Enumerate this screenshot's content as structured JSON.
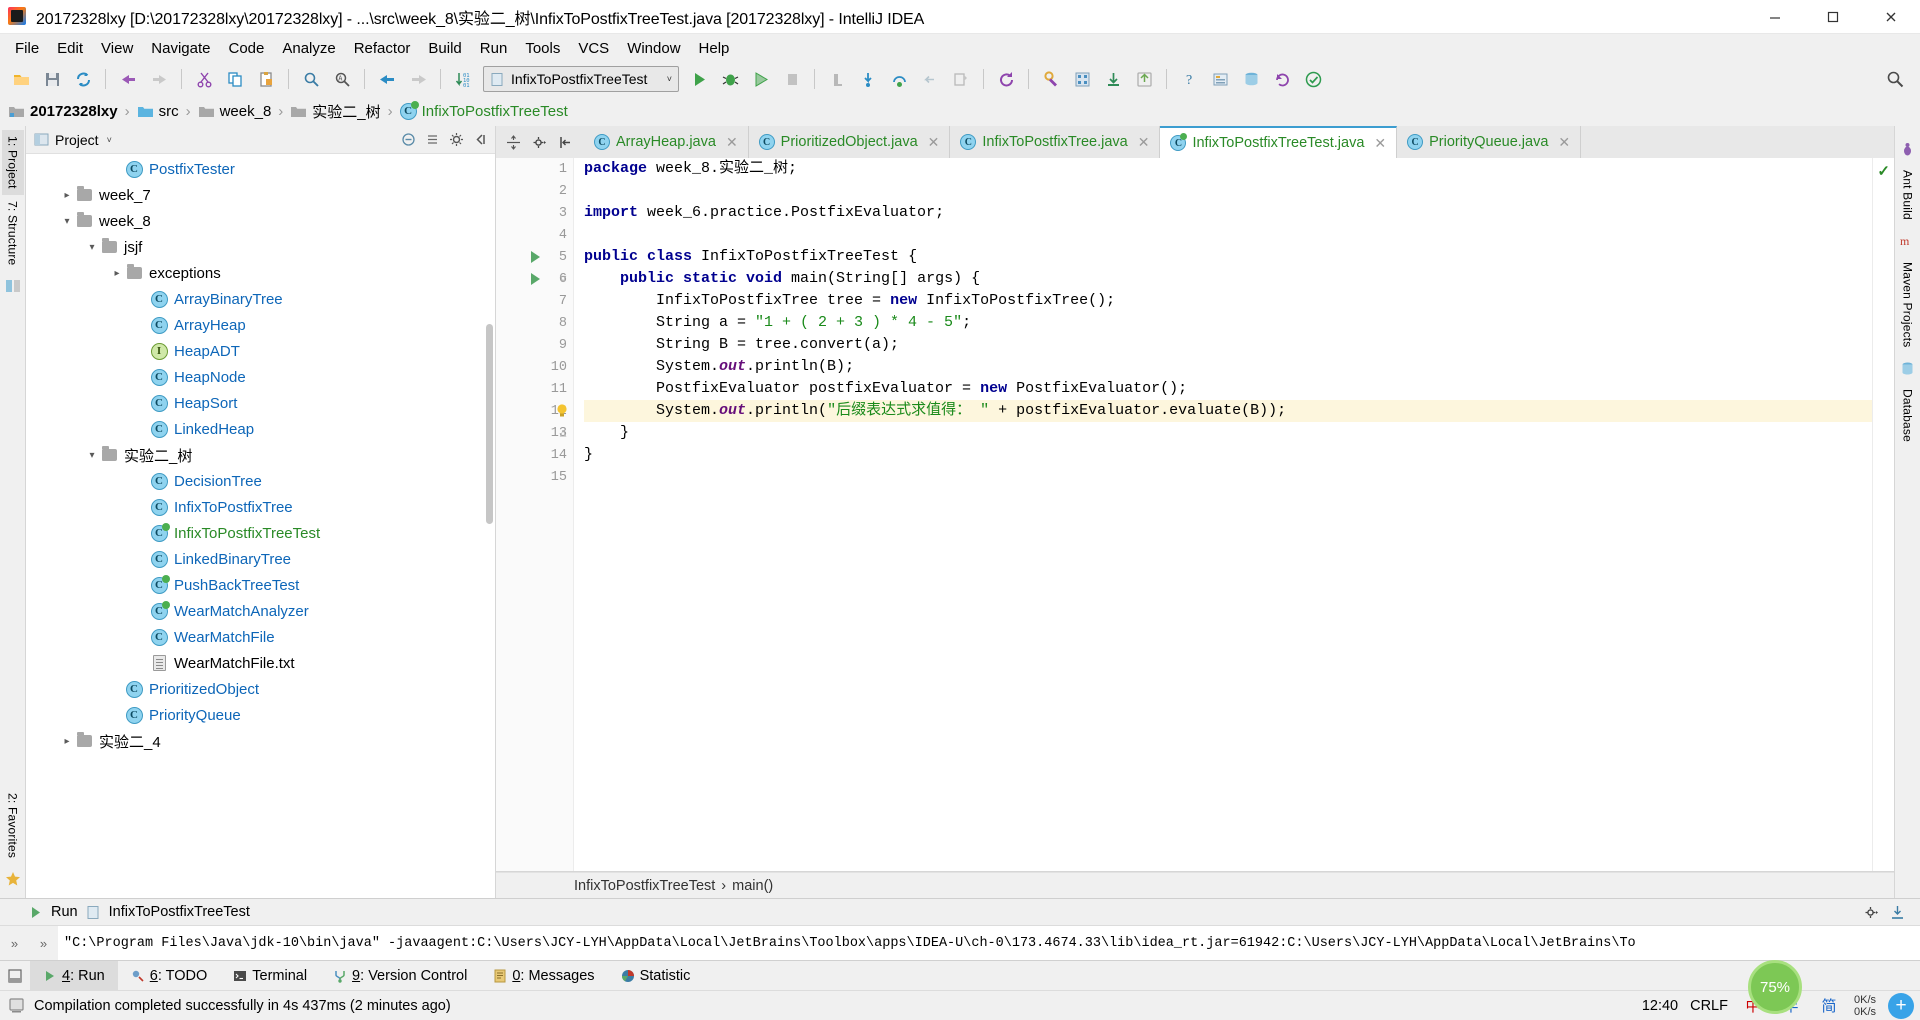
{
  "window": {
    "title": "20172328lxy [D:\\20172328lxy\\20172328lxy] - ...\\src\\week_8\\实验二_树\\InfixToPostfixTreeTest.java [20172328lxy] - IntelliJ IDEA",
    "minimize": "—",
    "maximize": "▢",
    "close": "✕"
  },
  "menubar": {
    "items": [
      {
        "label": "File"
      },
      {
        "label": "Edit"
      },
      {
        "label": "View"
      },
      {
        "label": "Navigate"
      },
      {
        "label": "Code"
      },
      {
        "label": "Analyze"
      },
      {
        "label": "Refactor"
      },
      {
        "label": "Build"
      },
      {
        "label": "Run"
      },
      {
        "label": "Tools"
      },
      {
        "label": "VCS"
      },
      {
        "label": "Window"
      },
      {
        "label": "Help"
      }
    ]
  },
  "toolbar": {
    "run_config": "InfixToPostfixTreeTest",
    "caret": "˅",
    "icons": [
      "open-folder-icon",
      "save-all-icon",
      "sync-icon",
      "undo-icon",
      "redo-icon",
      "cut-icon",
      "copy-icon",
      "paste-icon",
      "find-icon",
      "replace-icon",
      "back-icon",
      "forward-icon",
      "sort-icon"
    ],
    "run_icons": [
      "run-icon",
      "debug-icon",
      "coverage-icon",
      "stop-icon",
      "stop-gray-icon",
      "step-in-icon",
      "step-over-icon",
      "step-out-icon",
      "evaluate-icon",
      "rerun-icon",
      "settings-wrench-icon",
      "database-icon",
      "help-icon",
      "project-structure-icon",
      "update-icon",
      "check-icon"
    ],
    "search_everywhere": "search-everywhere-icon"
  },
  "breadcrumb": {
    "items": [
      {
        "label": "20172328lxy",
        "icon": "module-icon",
        "style": "bold"
      },
      {
        "label": "src",
        "icon": "source-folder-icon",
        "style": "normal"
      },
      {
        "label": "week_8",
        "icon": "folder-icon",
        "style": "normal"
      },
      {
        "label": "实验二_树",
        "icon": "folder-icon",
        "style": "normal"
      },
      {
        "label": "InfixToPostfixTreeTest",
        "icon": "class-icon",
        "style": "green"
      }
    ],
    "separator": "›"
  },
  "left_rail": {
    "tabs": [
      {
        "label": "1: Project",
        "selected": true
      },
      {
        "label": "7: Structure",
        "selected": false
      }
    ],
    "bottom": [
      {
        "label": "2: Favorites"
      }
    ],
    "icons": [
      "database-rail-icon",
      "commander-icon",
      "favorites-star-icon"
    ]
  },
  "right_rail": {
    "tabs": [
      {
        "label": "Ant Build"
      },
      {
        "label": "Maven Projects"
      },
      {
        "label": "Database"
      }
    ]
  },
  "project_panel": {
    "title": "Project",
    "caret": "˅",
    "buttons": [
      "collapse-all-icon",
      "expand-icon",
      "settings-gear-icon",
      "hide-icon"
    ],
    "tree": [
      {
        "indent": 3,
        "arrow": "",
        "icon": "class",
        "label": "PostfixTester",
        "color": "blue"
      },
      {
        "indent": 1,
        "arrow": "›",
        "icon": "folder",
        "label": "week_7",
        "color": "black"
      },
      {
        "indent": 1,
        "arrow": "˅",
        "icon": "folder",
        "label": "week_8",
        "color": "black"
      },
      {
        "indent": 2,
        "arrow": "˅",
        "icon": "folder",
        "label": "jsjf",
        "color": "black"
      },
      {
        "indent": 3,
        "arrow": "›",
        "icon": "folder",
        "label": "exceptions",
        "color": "black"
      },
      {
        "indent": 4,
        "arrow": "",
        "icon": "class",
        "label": "ArrayBinaryTree",
        "color": "blue"
      },
      {
        "indent": 4,
        "arrow": "",
        "icon": "class",
        "label": "ArrayHeap",
        "color": "blue"
      },
      {
        "indent": 4,
        "arrow": "",
        "icon": "interface",
        "label": "HeapADT",
        "color": "blue"
      },
      {
        "indent": 4,
        "arrow": "",
        "icon": "class",
        "label": "HeapNode",
        "color": "blue"
      },
      {
        "indent": 4,
        "arrow": "",
        "icon": "class",
        "label": "HeapSort",
        "color": "blue"
      },
      {
        "indent": 4,
        "arrow": "",
        "icon": "class",
        "label": "LinkedHeap",
        "color": "blue"
      },
      {
        "indent": 2,
        "arrow": "˅",
        "icon": "folder",
        "label": "实验二_树",
        "color": "black"
      },
      {
        "indent": 4,
        "arrow": "",
        "icon": "class",
        "label": "DecisionTree",
        "color": "blue"
      },
      {
        "indent": 4,
        "arrow": "",
        "icon": "class",
        "label": "InfixToPostfixTree",
        "color": "blue"
      },
      {
        "indent": 4,
        "arrow": "",
        "icon": "class-runnable",
        "label": "InfixToPostfixTreeTest",
        "color": "green"
      },
      {
        "indent": 4,
        "arrow": "",
        "icon": "class",
        "label": "LinkedBinaryTree",
        "color": "blue"
      },
      {
        "indent": 4,
        "arrow": "",
        "icon": "class-runnable",
        "label": "PushBackTreeTest",
        "color": "blue"
      },
      {
        "indent": 4,
        "arrow": "",
        "icon": "class-runnable",
        "label": "WearMatchAnalyzer",
        "color": "blue"
      },
      {
        "indent": 4,
        "arrow": "",
        "icon": "class",
        "label": "WearMatchFile",
        "color": "blue"
      },
      {
        "indent": 4,
        "arrow": "",
        "icon": "text",
        "label": "WearMatchFile.txt",
        "color": "black"
      },
      {
        "indent": 3,
        "arrow": "",
        "icon": "class",
        "label": "PrioritizedObject",
        "color": "blue"
      },
      {
        "indent": 3,
        "arrow": "",
        "icon": "class",
        "label": "PriorityQueue",
        "color": "blue"
      },
      {
        "indent": 1,
        "arrow": "›",
        "icon": "folder",
        "label": "实验二_4",
        "color": "black"
      }
    ]
  },
  "editor": {
    "tabs": [
      {
        "label": "ArrayHeap.java",
        "icon": "class-icon",
        "active": false,
        "close": "✕"
      },
      {
        "label": "PrioritizedObject.java",
        "icon": "class-icon",
        "active": false,
        "close": "✕"
      },
      {
        "label": "InfixToPostfixTree.java",
        "icon": "class-icon",
        "active": false,
        "close": "✕"
      },
      {
        "label": "InfixToPostfixTreeTest.java",
        "icon": "class-runnable-icon",
        "active": true,
        "close": "✕"
      },
      {
        "label": "PriorityQueue.java",
        "icon": "class-icon",
        "active": false,
        "close": "✕"
      }
    ],
    "tab_actions": [
      "split-icon",
      "settings-gear-icon",
      "back-to-editor-icon"
    ],
    "line_numbers": [
      "1",
      "2",
      "3",
      "4",
      "5",
      "6",
      "7",
      "8",
      "9",
      "10",
      "11",
      "12",
      "13",
      "14",
      "15"
    ],
    "gutter_run_lines": [
      5,
      6
    ],
    "bulb_line": 12,
    "fold_lines": [
      6,
      13
    ],
    "highlight_line": 12,
    "inspection_ok": "✓",
    "code_lines": [
      {
        "n": 1,
        "segments": [
          {
            "t": "package ",
            "c": "kw"
          },
          {
            "t": "week_8.实验二_树;",
            "c": "plain"
          }
        ]
      },
      {
        "n": 2,
        "segments": []
      },
      {
        "n": 3,
        "segments": [
          {
            "t": "import ",
            "c": "kw"
          },
          {
            "t": "week_6.practice.PostfixEvaluator;",
            "c": "plain"
          }
        ]
      },
      {
        "n": 4,
        "segments": []
      },
      {
        "n": 5,
        "segments": [
          {
            "t": "public class ",
            "c": "kw"
          },
          {
            "t": "InfixToPostfixTreeTest {",
            "c": "plain"
          }
        ]
      },
      {
        "n": 6,
        "segments": [
          {
            "t": "    public static void ",
            "c": "kw"
          },
          {
            "t": "main(String[] args) {",
            "c": "plain"
          }
        ]
      },
      {
        "n": 7,
        "segments": [
          {
            "t": "        InfixToPostfixTree tree = ",
            "c": "plain"
          },
          {
            "t": "new ",
            "c": "kw"
          },
          {
            "t": "InfixToPostfixTree();",
            "c": "plain"
          }
        ]
      },
      {
        "n": 8,
        "segments": [
          {
            "t": "        String a = ",
            "c": "plain"
          },
          {
            "t": "\"1 + ( 2 + 3 ) * 4 - 5\"",
            "c": "str"
          },
          {
            "t": ";",
            "c": "plain"
          }
        ]
      },
      {
        "n": 9,
        "segments": [
          {
            "t": "        String B = tree.convert(a);",
            "c": "plain"
          }
        ]
      },
      {
        "n": 10,
        "segments": [
          {
            "t": "        System.",
            "c": "plain"
          },
          {
            "t": "out",
            "c": "fld"
          },
          {
            "t": ".println(B);",
            "c": "plain"
          }
        ]
      },
      {
        "n": 11,
        "segments": [
          {
            "t": "        PostfixEvaluator postfixEvaluator = ",
            "c": "plain"
          },
          {
            "t": "new ",
            "c": "kw"
          },
          {
            "t": "PostfixEvaluator();",
            "c": "plain"
          }
        ]
      },
      {
        "n": 12,
        "segments": [
          {
            "t": "        System.",
            "c": "plain"
          },
          {
            "t": "out",
            "c": "fld"
          },
          {
            "t": ".println(",
            "c": "plain"
          },
          {
            "t": "\"后缀表达式求值得： \"",
            "c": "str"
          },
          {
            "t": " + postfixEvaluator.evaluate(B));",
            "c": "plain"
          }
        ]
      },
      {
        "n": 13,
        "segments": [
          {
            "t": "    }",
            "c": "plain"
          }
        ]
      },
      {
        "n": 14,
        "segments": [
          {
            "t": "}",
            "c": "plain"
          }
        ]
      },
      {
        "n": 15,
        "segments": []
      }
    ],
    "editor_breadcrumb": {
      "items": [
        "InfixToPostfixTreeTest",
        "main()"
      ],
      "separator": "›"
    }
  },
  "run_panel": {
    "label": "Run",
    "config_name": "InfixToPostfixTreeTest",
    "expand_icons": [
      "»",
      "»"
    ],
    "header_icons": [
      "settings-gear-icon",
      "export-icon"
    ],
    "console_output": "\"C:\\Program Files\\Java\\jdk-10\\bin\\java\" -javaagent:C:\\Users\\JCY-LYH\\AppData\\Local\\JetBrains\\Toolbox\\apps\\IDEA-U\\ch-0\\173.4674.33\\lib\\idea_rt.jar=61942:C:\\Users\\JCY-LYH\\AppData\\Local\\JetBrains\\To"
  },
  "bottom_tabs": [
    {
      "num": "4",
      "label": "Run",
      "icon": "run-icon",
      "selected": true
    },
    {
      "num": "6",
      "label": "TODO",
      "icon": "todo-icon",
      "selected": false
    },
    {
      "num": "",
      "label": "Terminal",
      "icon": "terminal-icon",
      "selected": false
    },
    {
      "num": "9",
      "label": "Version Control",
      "icon": "vcs-icon",
      "selected": false
    },
    {
      "num": "0",
      "label": "Messages",
      "icon": "messages-icon",
      "selected": false
    },
    {
      "num": "",
      "label": "Statistic",
      "icon": "statistic-icon",
      "selected": false
    }
  ],
  "statusbar": {
    "message": "Compilation completed successfully in 4s 437ms (2 minutes ago)",
    "time": "12:40",
    "line_separator": "CRLF",
    "ime_cn": "中",
    "ime_half": "半",
    "ime_simplified": "简",
    "zoom_level": "75%",
    "net_up": "0K/s",
    "net_down": "0K/s",
    "plus": "+"
  },
  "colors": {
    "accent_blue": "#3c9dd0",
    "green_run": "#59a869",
    "string_green": "#1a8a1a",
    "keyword_navy": "#00008f",
    "field_purple": "#660e7a",
    "highlight_yellow": "#fdf6dd",
    "panel_gray": "#f0f0f0"
  }
}
